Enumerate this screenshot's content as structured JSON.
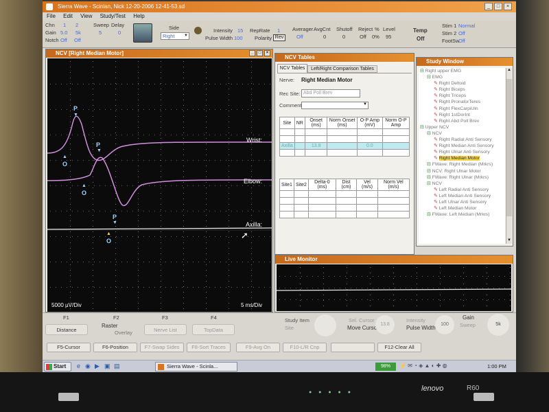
{
  "window": {
    "title": "Sierra Wave - Scinlan, Nick 12-20-2006 12-41-53.sd",
    "menu": [
      "File",
      "Edit",
      "View",
      "Study/Test",
      "Help"
    ]
  },
  "toolbar": {
    "chn_label": "Chn",
    "chn_values": [
      "1",
      "2"
    ],
    "gain_label": "Gain",
    "gain_values": [
      "5.0",
      "5k"
    ],
    "notch_label": "Notch",
    "notch_values": [
      "Off",
      "Off"
    ],
    "sweep_label": "Sweep",
    "delay_label": "Delay",
    "sweep_values": [
      "5",
      "0"
    ],
    "side_label": "Side",
    "side_value": "Right",
    "intensity_label": "Intensity",
    "intensity_value": "15",
    "pulse_width_label": "Pulse Width",
    "pulse_width_value": "100",
    "reprate_label": "RepRate",
    "reprate_value": "1",
    "polarity_label": "Polarity",
    "polarity_value": "Rev",
    "averager_label": "Averager",
    "averager_value": "Off",
    "avgcnt_label": "AvgCnt",
    "avgcnt_value": "0",
    "shutoff_label": "Shutoff",
    "shutoff_value": "0",
    "reject_label": "Reject",
    "reject_value": "Off",
    "pct_label": "%",
    "pct_value": "0%",
    "level_label": "Level",
    "level_value": "95",
    "temp_label": "Temp",
    "temp_value": "Off",
    "stim1_label": "Stim 1",
    "stim1_value": "Normal",
    "stim2_label": "Stim 2",
    "stim2_value": "Off",
    "footsw_label": "FootSw",
    "footsw_value": "Off"
  },
  "ncv_panel": {
    "title": "NCV [Right Median Motor]",
    "traces": [
      {
        "label": "Wrist",
        "peak_label": "P",
        "onset_label": "O"
      },
      {
        "label": "Elbow",
        "peak_label": "P",
        "onset_label": "O"
      },
      {
        "label": "Axilla",
        "peak_label": "P",
        "onset_label": "O"
      }
    ],
    "sensitivity": "5000 µV/Div",
    "timebase": "5 ms/Div"
  },
  "tables_panel": {
    "title": "NCV Tables",
    "tabs": [
      "NCV Tables",
      "Left/Right Comparison Tables"
    ],
    "nerve_label": "Nerve:",
    "nerve_value": "Right Median Motor",
    "rec_site_label": "Rec Site:",
    "rec_site_value": "Abd Poll Brev",
    "comment_label": "Comment",
    "comment_value": "",
    "table1_headers": [
      "Site",
      "NR",
      "Onset (ms)",
      "Norm Onset (ms)",
      "O-P Amp (mV)",
      "Norm O-P Amp"
    ],
    "table1_rows": [
      [
        "",
        "",
        "",
        "",
        "",
        ""
      ],
      [
        "",
        "",
        "",
        "",
        "",
        ""
      ],
      [
        "Axilla",
        "",
        "13.8",
        "",
        "0.0",
        ""
      ],
      [
        "",
        "",
        "",
        "",
        "",
        ""
      ]
    ],
    "table2_headers": [
      "Site1",
      "Site2",
      "Delta-0 (ms)",
      "Dist (cm)",
      "Vel (m/s)",
      "Norm Vel (m/s)"
    ],
    "table2_rows": [
      [
        "",
        "",
        "",
        "",
        "",
        ""
      ],
      [
        "",
        "",
        "",
        "",
        "",
        ""
      ],
      [
        "",
        "",
        "",
        "",
        "",
        ""
      ],
      [
        "",
        "",
        "",
        "",
        "",
        ""
      ]
    ]
  },
  "study_panel": {
    "title": "Study Window",
    "items": [
      {
        "label": "Right upper EMG",
        "level": 0
      },
      {
        "label": "EMG",
        "level": 1
      },
      {
        "label": "Right Deltoid",
        "level": 2
      },
      {
        "label": "Right Biceps",
        "level": 2
      },
      {
        "label": "Right Triceps",
        "level": 2
      },
      {
        "label": "Right PronatorTeres",
        "level": 2
      },
      {
        "label": "Right FlexCarpiUln",
        "level": 2
      },
      {
        "label": "Right 1stDorInt",
        "level": 2
      },
      {
        "label": "Right Abd Poll Brev",
        "level": 2
      },
      {
        "label": "Upper NCV",
        "level": 0
      },
      {
        "label": "NCV",
        "level": 1
      },
      {
        "label": "Right Radial Anti Sensory",
        "level": 2
      },
      {
        "label": "Right Median Anti Sensory",
        "level": 2
      },
      {
        "label": "Right Ulnar Anti Sensory",
        "level": 2
      },
      {
        "label": "Right Median Motor",
        "level": 2,
        "selected": true
      },
      {
        "label": "FWave: Right Median (Mrkrs)",
        "level": 1
      },
      {
        "label": "NCV: Right Ulnar Motor",
        "level": 1
      },
      {
        "label": "FWave: Right Ulnar (Mrkrs)",
        "level": 1
      },
      {
        "label": "NCV",
        "level": 1
      },
      {
        "label": "Left Radial Anti Sensory",
        "level": 2
      },
      {
        "label": "Left Median Anti Sensory",
        "level": 2
      },
      {
        "label": "Left Ulnar Anti Sensory",
        "level": 2
      },
      {
        "label": "Left Median Motor",
        "level": 2
      },
      {
        "label": "FWave: Left Median (Mrkrs)",
        "level": 1
      }
    ]
  },
  "live_monitor": {
    "title": "Live Monitor"
  },
  "fn_bar": {
    "f1": "F1",
    "f2": "F2",
    "f3": "F3",
    "f4": "F4",
    "distance": "Distance",
    "raster": "Raster",
    "overlay": "Overlay",
    "nerve_list": "Nerve List",
    "topdata": "TopData",
    "study_item": "Study Item",
    "site": "Site",
    "sel_cursor": "Sel. Cursor",
    "move_cursor": "Move Cursor",
    "cursor_value": "13.8",
    "intensity": "Intensity",
    "pulse_width": "Pulse Width",
    "pw_value": "100",
    "gain": "Gain",
    "sweep": "Sweep",
    "gain_value": "5k"
  },
  "fkeys": [
    "F5-Cursor",
    "F6-Position",
    "F7-Swap Sides",
    "F8-Sort Traces",
    "F9-Avg On",
    "F10-L/R Cnp",
    "",
    "F12-Clear All"
  ],
  "taskbar": {
    "start": "Start",
    "task": "Sierra Wave - Scinla...",
    "battery": "98%",
    "clock": "1:00 PM"
  },
  "laptop": {
    "brand": "lenovo",
    "model": "R60"
  }
}
